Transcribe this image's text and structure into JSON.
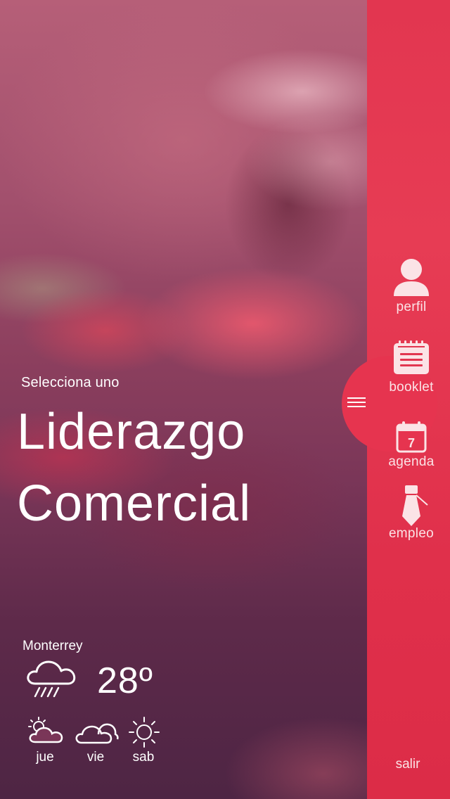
{
  "header": {
    "subtitle": "Selecciona uno",
    "title_line_1": "Liderazgo",
    "title_line_2": "Comercial"
  },
  "weather": {
    "city": "Monterrey",
    "temperature": "28º",
    "current_icon": "rain-cloud-icon",
    "forecast": [
      {
        "day": "jue",
        "icon": "partly-cloudy-icon"
      },
      {
        "day": "vie",
        "icon": "cloudy-icon"
      },
      {
        "day": "sab",
        "icon": "sun-icon"
      }
    ]
  },
  "sidebar": {
    "items": [
      {
        "label": "perfil",
        "icon": "user-icon"
      },
      {
        "label": "booklet",
        "icon": "notebook-icon"
      },
      {
        "label": "agenda",
        "icon": "calendar-icon",
        "calendar_day": "7"
      },
      {
        "label": "empleo",
        "icon": "tie-icon"
      }
    ],
    "logout_label": "salir",
    "menu_icon": "hamburger-icon"
  },
  "colors": {
    "accent": "#e23650",
    "text": "#ffffff",
    "sidebar_text": "#fbe3e6"
  }
}
